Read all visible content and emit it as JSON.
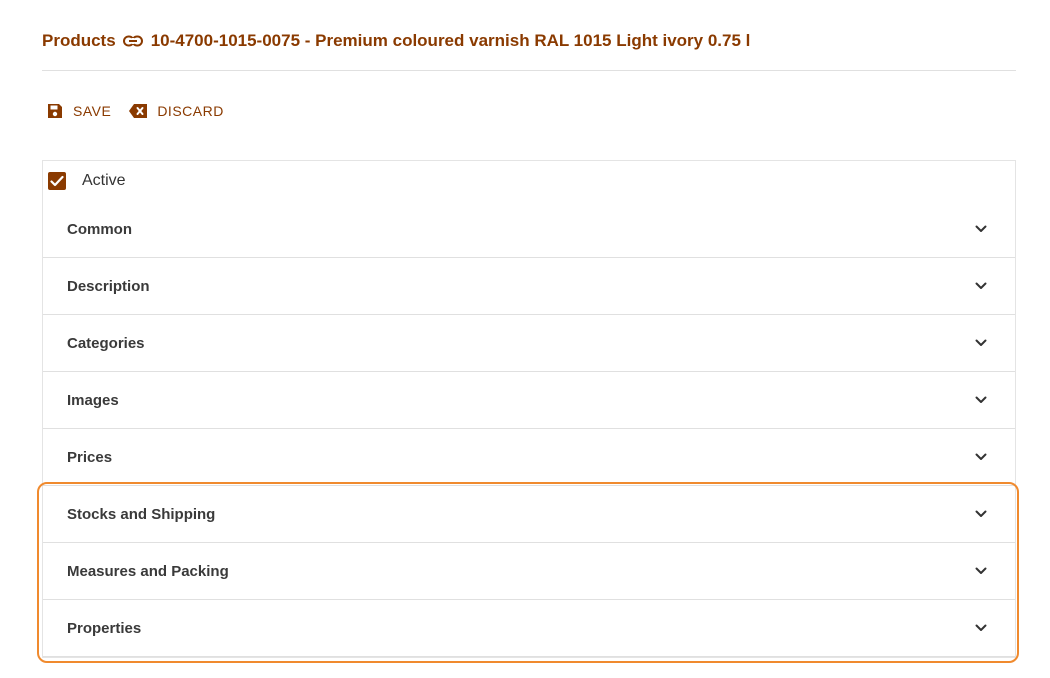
{
  "header": {
    "breadcrumb_root": "Products",
    "record_title": "10-4700-1015-0075 - Premium coloured varnish RAL 1015 Light ivory 0.75 l"
  },
  "toolbar": {
    "save_label": "SAVE",
    "discard_label": "DISCARD"
  },
  "form": {
    "active_label": "Active",
    "active_checked": true
  },
  "sections": [
    {
      "label": "Common"
    },
    {
      "label": "Description"
    },
    {
      "label": "Categories"
    },
    {
      "label": "Images"
    },
    {
      "label": "Prices"
    },
    {
      "label": "Stocks and Shipping"
    },
    {
      "label": "Measures and Packing"
    },
    {
      "label": "Properties"
    }
  ],
  "colors": {
    "accent": "#8a3a00",
    "highlight": "#f08a2e"
  }
}
